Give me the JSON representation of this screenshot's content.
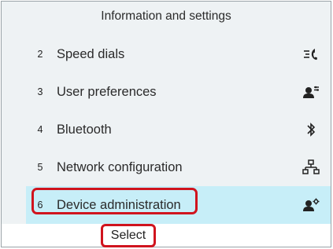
{
  "screen": {
    "title": "Information and settings"
  },
  "menu": {
    "items": [
      {
        "number": "2",
        "label": "Speed dials",
        "icon": "speed-dial-icon"
      },
      {
        "number": "3",
        "label": "User preferences",
        "icon": "user-preferences-icon"
      },
      {
        "number": "4",
        "label": "Bluetooth",
        "icon": "bluetooth-icon"
      },
      {
        "number": "5",
        "label": "Network configuration",
        "icon": "network-icon"
      },
      {
        "number": "6",
        "label": "Device administration",
        "icon": "device-admin-icon",
        "selected": true
      }
    ]
  },
  "softkeys": {
    "select_label": "Select"
  },
  "colors": {
    "selection": "#c7eef8",
    "highlight_border": "#d0141e",
    "background": "#eef2f4"
  }
}
